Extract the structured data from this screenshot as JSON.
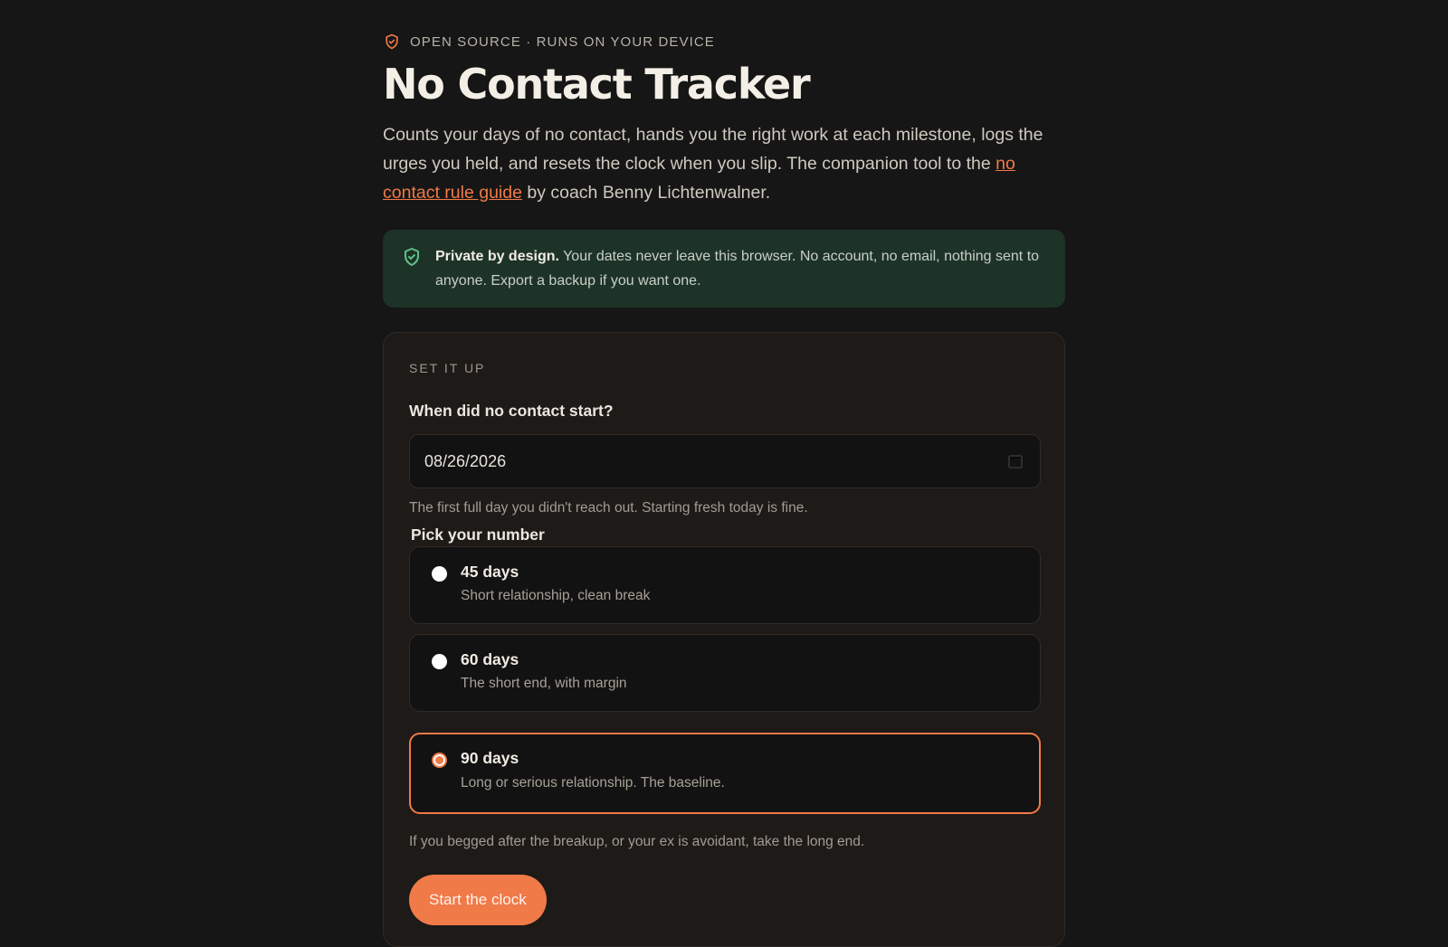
{
  "header": {
    "eyebrow": "OPEN SOURCE · RUNS ON YOUR DEVICE",
    "title": "No Contact Tracker",
    "intro_before": "Counts your days of no contact, hands you the right work at each milestone, logs the urges you held, and resets the clock when you slip. The companion tool to the ",
    "intro_link": "no contact rule guide",
    "intro_after": " by coach Benny Lichtenwalner."
  },
  "privacy": {
    "bold": "Private by design.",
    "text": " Your dates never leave this browser. No account, no email, nothing sent to anyone. Export a backup if you want one."
  },
  "setup": {
    "section_label": "SET IT UP",
    "date_label": "When did no contact start?",
    "date_value": "08/26/2026",
    "date_hint": "The first full day you didn't reach out. Starting fresh today is fine.",
    "pick_label": "Pick your number",
    "options": [
      {
        "title": "45 days",
        "desc": "Short relationship, clean break",
        "selected": false
      },
      {
        "title": "60 days",
        "desc": "The short end, with margin",
        "selected": false
      },
      {
        "title": "90 days",
        "desc": "Long or serious relationship. The baseline.",
        "selected": true
      }
    ],
    "pick_hint": "If you begged after the breakup, or your ex is avoidant, take the long end.",
    "start_label": "Start the clock"
  },
  "colors": {
    "accent": "#f07a48",
    "privacy_bg": "#1e3328",
    "privacy_icon": "#5fbf8a"
  }
}
